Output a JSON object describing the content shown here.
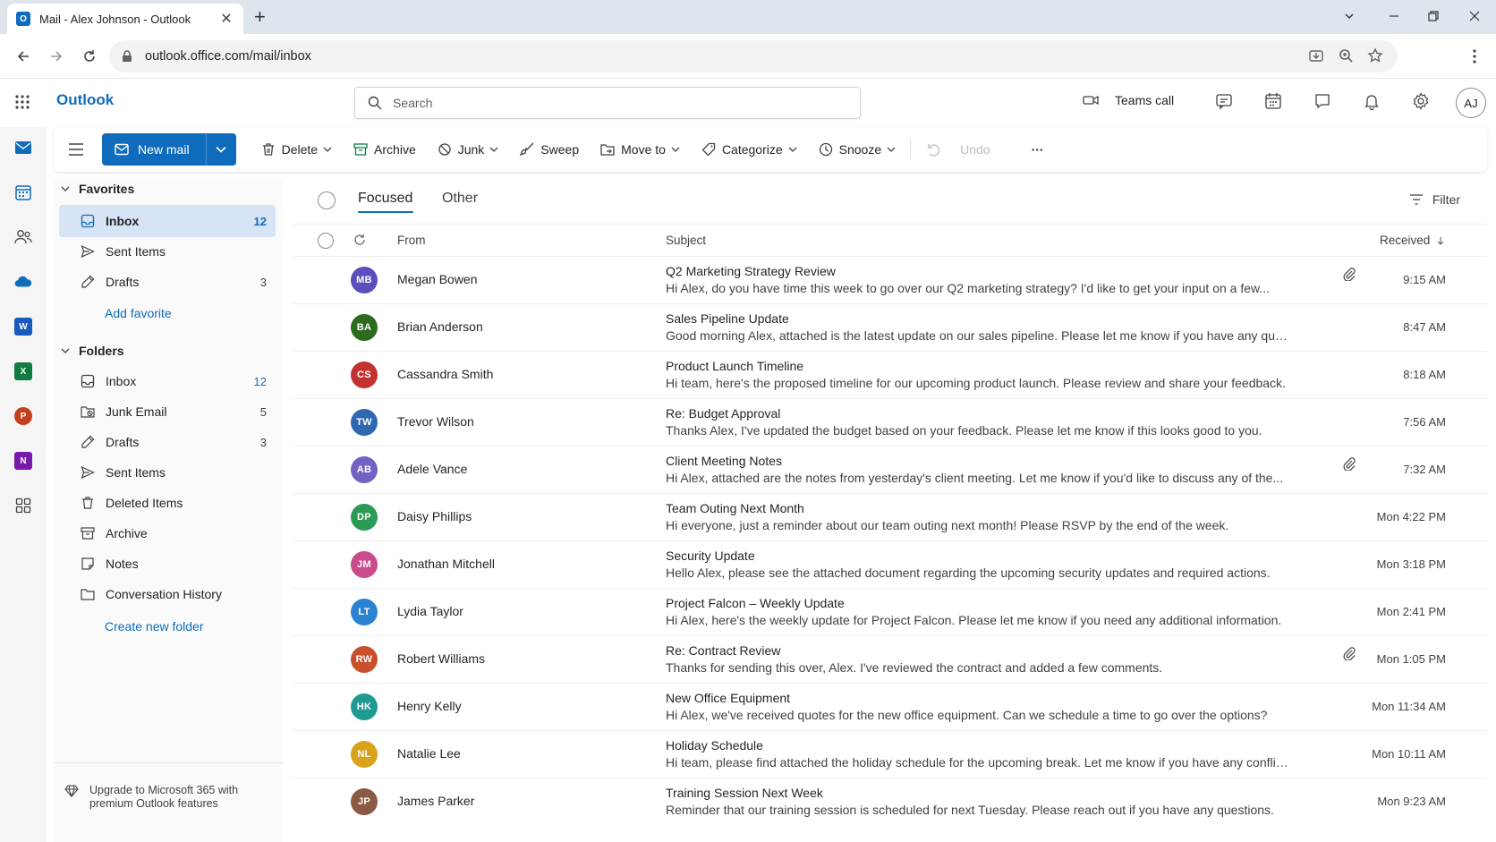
{
  "browser": {
    "tab_title": "Mail - Alex Johnson - Outlook",
    "tab_favicon": "O",
    "new_tab": "+",
    "tab_close": "✕",
    "url": "outlook.office.com/mail/inbox"
  },
  "header": {
    "brand": "Outlook",
    "search_placeholder": "Search",
    "teams_call": "Teams call",
    "avatar_initials": "AJ"
  },
  "rail": {
    "icons": [
      "mail-icon",
      "calendar-icon",
      "people-icon",
      "onedrive-icon",
      "word-icon",
      "excel-icon",
      "powerpoint-icon",
      "onenote-icon",
      "more-apps-icon"
    ],
    "word": "W",
    "excel": "X",
    "powerpoint": "P",
    "onenote": "N"
  },
  "toolbar": {
    "new_mail": "New mail",
    "delete": "Delete",
    "archive": "Archive",
    "junk": "Junk",
    "sweep": "Sweep",
    "move_to": "Move to",
    "categorize": "Categorize",
    "snooze": "Snooze",
    "undo": "Undo",
    "more": "···"
  },
  "favorites": {
    "heading": "Favorites",
    "items": [
      {
        "label": "Inbox",
        "count": "12"
      },
      {
        "label": "Sent Items",
        "count": ""
      },
      {
        "label": "Drafts",
        "count": "3"
      }
    ],
    "add_favorite": "Add favorite"
  },
  "folders": {
    "heading": "Folders",
    "items": [
      {
        "label": "Inbox",
        "count": "12"
      },
      {
        "label": "Junk Email",
        "count": "5"
      },
      {
        "label": "Drafts",
        "count": "3"
      },
      {
        "label": "Sent Items",
        "count": ""
      },
      {
        "label": "Deleted Items",
        "count": ""
      },
      {
        "label": "Archive",
        "count": ""
      },
      {
        "label": "Notes",
        "count": ""
      },
      {
        "label": "Conversation History",
        "count": ""
      }
    ],
    "create_new": "Create new folder"
  },
  "upgrade": {
    "line1": "Upgrade to Microsoft 365 with",
    "line2": "premium Outlook features"
  },
  "list": {
    "tab_focused": "Focused",
    "tab_other": "Other",
    "filter": "Filter",
    "col_from": "From",
    "col_subject": "Subject",
    "col_received": "Received",
    "messages": [
      {
        "initials": "MB",
        "color": "#5b4fbe",
        "sender": "Megan Bowen",
        "subject": "Q2 Marketing Strategy Review",
        "preview": "Hi Alex, do you have time this week to go over our Q2 marketing strategy? I'd like to get your input on a few...",
        "time": "9:15 AM",
        "attachment": true
      },
      {
        "initials": "BA",
        "color": "#2e6b1f",
        "sender": "Brian Anderson",
        "subject": "Sales Pipeline Update",
        "preview": "Good morning Alex, attached is the latest update on our sales pipeline. Please let me know if you have any que...",
        "time": "8:47 AM",
        "attachment": false
      },
      {
        "initials": "CS",
        "color": "#c43131",
        "sender": "Cassandra Smith",
        "subject": "Product Launch Timeline",
        "preview": "Hi team, here's the proposed timeline for our upcoming product launch. Please review and share your feedback.",
        "time": "8:18 AM",
        "attachment": false
      },
      {
        "initials": "TW",
        "color": "#2f68b0",
        "sender": "Trevor Wilson",
        "subject": "Re: Budget Approval",
        "preview": "Thanks Alex, I've updated the budget based on your feedback. Please let me know if this looks good to you.",
        "time": "7:56 AM",
        "attachment": false
      },
      {
        "initials": "AB",
        "color": "#7461c4",
        "sender": "Adele Vance",
        "subject": "Client Meeting Notes",
        "preview": "Hi Alex, attached are the notes from yesterday's client meeting. Let me know if you'd like to discuss any of the...",
        "time": "7:32 AM",
        "attachment": true
      },
      {
        "initials": "DP",
        "color": "#2b9a55",
        "sender": "Daisy Phillips",
        "subject": "Team Outing Next Month",
        "preview": "Hi everyone, just a reminder about our team outing next month! Please RSVP by the end of the week.",
        "time": "Mon 4:22 PM",
        "attachment": false
      },
      {
        "initials": "JM",
        "color": "#c94b8e",
        "sender": "Jonathan Mitchell",
        "subject": "Security Update",
        "preview": "Hello Alex, please see the attached document regarding the upcoming security updates and required actions.",
        "time": "Mon 3:18 PM",
        "attachment": false
      },
      {
        "initials": "LT",
        "color": "#2b82d2",
        "sender": "Lydia Taylor",
        "subject": "Project Falcon – Weekly Update",
        "preview": "Hi Alex, here's the weekly update for Project Falcon. Please let me know if you need any additional information.",
        "time": "Mon 2:41 PM",
        "attachment": false
      },
      {
        "initials": "RW",
        "color": "#c9502c",
        "sender": "Robert Williams",
        "subject": "Re: Contract Review",
        "preview": "Thanks for sending this over, Alex. I've reviewed the contract and added a few comments.",
        "time": "Mon 1:05 PM",
        "attachment": true
      },
      {
        "initials": "HK",
        "color": "#1f9a92",
        "sender": "Henry Kelly",
        "subject": "New Office Equipment",
        "preview": "Hi Alex, we've received quotes for the new office equipment. Can we schedule a time to go over the options?",
        "time": "Mon 11:34 AM",
        "attachment": false
      },
      {
        "initials": "NL",
        "color": "#d9a21b",
        "sender": "Natalie Lee",
        "subject": "Holiday Schedule",
        "preview": "Hi team, please find attached the holiday schedule for the upcoming break. Let me know if you have any conflict...",
        "time": "Mon 10:11 AM",
        "attachment": false
      },
      {
        "initials": "JP",
        "color": "#8a5a44",
        "sender": "James Parker",
        "subject": "Training Session Next Week",
        "preview": "Reminder that our training session is scheduled for next Tuesday. Please reach out if you have any questions.",
        "time": "Mon 9:23 AM",
        "attachment": false
      }
    ]
  }
}
